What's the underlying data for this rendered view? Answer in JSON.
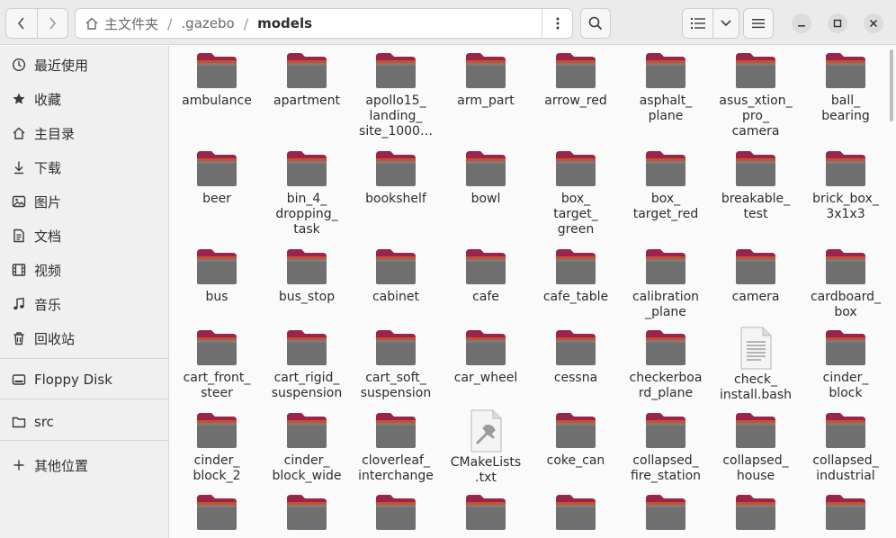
{
  "header": {
    "path": [
      "主文件夹",
      ".gazebo",
      "models"
    ]
  },
  "sidebar": {
    "items": [
      {
        "label": "最近使用",
        "icon": "clock-icon"
      },
      {
        "label": "收藏",
        "icon": "star-icon"
      },
      {
        "label": "主目录",
        "icon": "home-icon"
      },
      {
        "label": "下载",
        "icon": "download-icon"
      },
      {
        "label": "图片",
        "icon": "image-icon"
      },
      {
        "label": "文档",
        "icon": "document-icon"
      },
      {
        "label": "视频",
        "icon": "video-icon"
      },
      {
        "label": "音乐",
        "icon": "music-icon"
      },
      {
        "label": "回收站",
        "icon": "trash-icon"
      },
      {
        "label": "Floppy Disk",
        "icon": "drive-icon"
      },
      {
        "label": "src",
        "icon": "folder-icon"
      },
      {
        "label": "其他位置",
        "icon": "plus-icon"
      }
    ]
  },
  "files": [
    {
      "label": "ambulance",
      "type": "folder"
    },
    {
      "label": "apartment",
      "type": "folder"
    },
    {
      "label": "apollo15_\nlanding_\nsite_1000…",
      "type": "folder"
    },
    {
      "label": "arm_part",
      "type": "folder"
    },
    {
      "label": "arrow_red",
      "type": "folder"
    },
    {
      "label": "asphalt_\nplane",
      "type": "folder"
    },
    {
      "label": "asus_xtion_\npro_\ncamera",
      "type": "folder"
    },
    {
      "label": "ball_\nbearing",
      "type": "folder"
    },
    {
      "label": "beer",
      "type": "folder"
    },
    {
      "label": "bin_4_\ndropping_\ntask",
      "type": "folder"
    },
    {
      "label": "bookshelf",
      "type": "folder"
    },
    {
      "label": "bowl",
      "type": "folder"
    },
    {
      "label": "box_\ntarget_\ngreen",
      "type": "folder"
    },
    {
      "label": "box_\ntarget_red",
      "type": "folder"
    },
    {
      "label": "breakable_\ntest",
      "type": "folder"
    },
    {
      "label": "brick_box_\n3x1x3",
      "type": "folder"
    },
    {
      "label": "bus",
      "type": "folder"
    },
    {
      "label": "bus_stop",
      "type": "folder"
    },
    {
      "label": "cabinet",
      "type": "folder"
    },
    {
      "label": "cafe",
      "type": "folder"
    },
    {
      "label": "cafe_table",
      "type": "folder"
    },
    {
      "label": "calibration\n_plane",
      "type": "folder"
    },
    {
      "label": "camera",
      "type": "folder"
    },
    {
      "label": "cardboard_\nbox",
      "type": "folder"
    },
    {
      "label": "cart_front_\nsteer",
      "type": "folder"
    },
    {
      "label": "cart_rigid_\nsuspension",
      "type": "folder"
    },
    {
      "label": "cart_soft_\nsuspension",
      "type": "folder"
    },
    {
      "label": "car_wheel",
      "type": "folder"
    },
    {
      "label": "cessna",
      "type": "folder"
    },
    {
      "label": "checkerboa\nrd_plane",
      "type": "folder"
    },
    {
      "label": "check_\ninstall.bash",
      "type": "textfile"
    },
    {
      "label": "cinder_\nblock",
      "type": "folder"
    },
    {
      "label": "cinder_\nblock_2",
      "type": "folder"
    },
    {
      "label": "cinder_\nblock_wide",
      "type": "folder"
    },
    {
      "label": "cloverleaf_\ninterchange",
      "type": "folder"
    },
    {
      "label": "CMakeLists\n.txt",
      "type": "cmakefile"
    },
    {
      "label": "coke_can",
      "type": "folder"
    },
    {
      "label": "collapsed_\nfire_station",
      "type": "folder"
    },
    {
      "label": "collapsed_\nhouse",
      "type": "folder"
    },
    {
      "label": "collapsed_\nindustrial",
      "type": "folder"
    },
    {
      "label": "",
      "type": "folder"
    },
    {
      "label": "",
      "type": "folder"
    },
    {
      "label": "",
      "type": "folder"
    },
    {
      "label": "",
      "type": "folder"
    },
    {
      "label": "",
      "type": "folder"
    },
    {
      "label": "",
      "type": "folder"
    },
    {
      "label": "",
      "type": "folder"
    },
    {
      "label": "",
      "type": "folder"
    }
  ],
  "colors": {
    "folder_top": "#9b2449",
    "folder_tab": "#c9502e",
    "folder_body": "#6f6f6f",
    "folder_body_light": "#7b7b7b"
  }
}
